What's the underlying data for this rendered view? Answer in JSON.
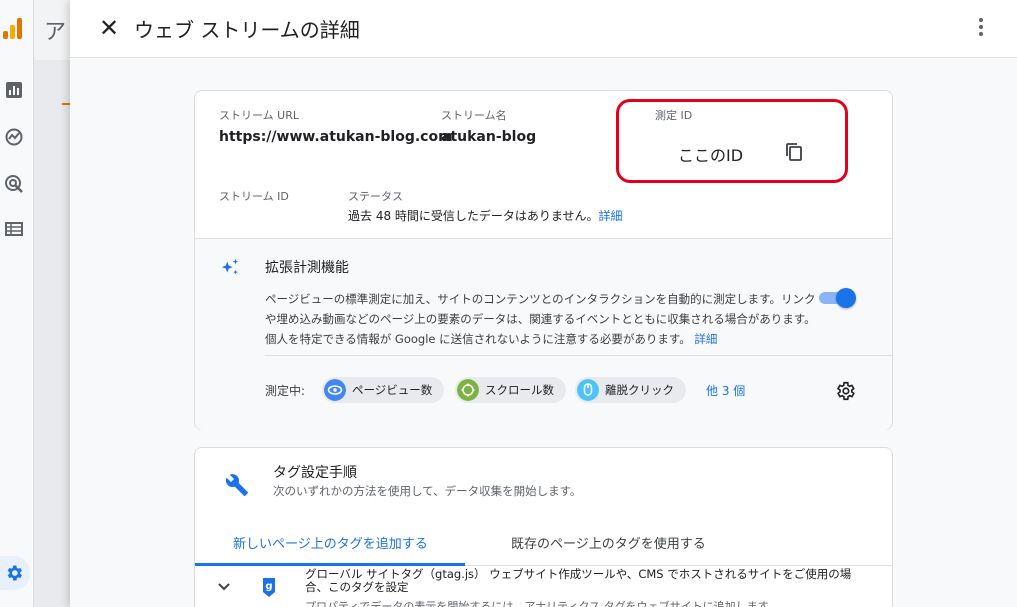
{
  "background": {
    "app_title": "ア"
  },
  "header": {
    "close_label": "✕",
    "title": "ウェブ ストリームの詳細"
  },
  "stream": {
    "url_label": "ストリーム URL",
    "url_value": "https://www.atukan-blog.com",
    "name_label": "ストリーム名",
    "name_value": "atukan-blog",
    "measurement_id_label": "測定 ID",
    "measurement_id_value": "ここのID",
    "stream_id_label": "ストリーム ID",
    "status_label": "ステータス",
    "status_text": "過去 48 時間に受信したデータはありません。",
    "status_link": "詳細"
  },
  "enhanced": {
    "title": "拡張計測機能",
    "description": "ページビューの標準測定に加え、サイトのコンテンツとのインタラクションを自動的に測定します。リンクや埋め込み動画などのページ上の要素のデータは、関連するイベントとともに収集される場合があります。個人を特定できる情報が Google に送信されないように注意する必要があります。",
    "description_link": "詳細",
    "toggle_on": true,
    "measuring_label": "測定中:",
    "chips": [
      {
        "label": "ページビュー数",
        "icon": "eye-icon",
        "color": "#4285f4"
      },
      {
        "label": "スクロール数",
        "icon": "scroll-icon",
        "color": "#7cb342"
      },
      {
        "label": "離脱クリック",
        "icon": "mouse-icon",
        "color": "#4fc3f7"
      }
    ],
    "more_link": "他 3 個"
  },
  "tagging": {
    "title": "タグ設定手順",
    "subtitle": "次のいずれかの方法を使用して、データ収集を開始します。",
    "tabs": [
      {
        "label": "新しいページ上のタグを追加する",
        "active": true
      },
      {
        "label": "既存のページ上のタグを使用する",
        "active": false
      }
    ],
    "gtag_text": "グローバル サイトタグ（gtag.js） ウェブサイト作成ツールや、CMS でホストされるサイトをご使用の場合、このタグを設定",
    "gtag_sub": "プロパティでデータの表示を開始するには、アナリティクス タグをウェブサイトに追加します。"
  },
  "colors": {
    "accent": "#1a73e8",
    "highlight_box": "#e4001b"
  }
}
